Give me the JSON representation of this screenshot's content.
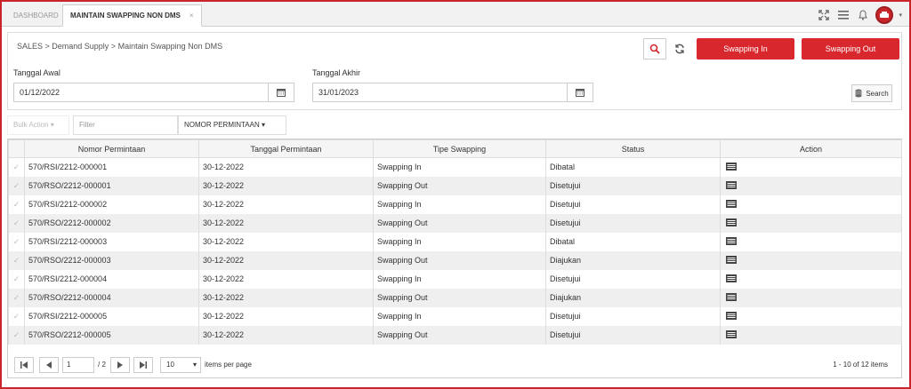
{
  "tabs": [
    {
      "label": "DASHBOARD"
    },
    {
      "label": "MAINTAIN SWAPPING NON DMS",
      "close": "×"
    }
  ],
  "icons": {
    "fullscreen": "expand-icon",
    "menu": "hamburger-icon",
    "bell": "bell-icon",
    "user": "avatar"
  },
  "breadcrumb": "SALES > Demand Supply > Maintain Swapping Non DMS",
  "actions": {
    "swap_in": "Swapping In",
    "swap_out": "Swapping Out"
  },
  "form": {
    "start_label": "Tanggal Awal",
    "start_value": "01/12/2022",
    "end_label": "Tanggal Akhir",
    "end_value": "31/01/2023",
    "search": "Search"
  },
  "toolbar": {
    "bulk": "Bulk Action ▾",
    "filter_placeholder": "Filter",
    "field": "NOMOR PERMINTAAN ▾"
  },
  "table": {
    "headers": [
      "Nomor Permintaan",
      "Tanggal Permintaan",
      "Tipe Swapping",
      "Status",
      "Action"
    ],
    "rows": [
      [
        "570/RSI/2212-000001",
        "30-12-2022",
        "Swapping In",
        "Dibatal"
      ],
      [
        "570/RSO/2212-000001",
        "30-12-2022",
        "Swapping Out",
        "Disetujui"
      ],
      [
        "570/RSI/2212-000002",
        "30-12-2022",
        "Swapping In",
        "Disetujui"
      ],
      [
        "570/RSO/2212-000002",
        "30-12-2022",
        "Swapping Out",
        "Disetujui"
      ],
      [
        "570/RSI/2212-000003",
        "30-12-2022",
        "Swapping In",
        "Dibatal"
      ],
      [
        "570/RSO/2212-000003",
        "30-12-2022",
        "Swapping Out",
        "Diajukan"
      ],
      [
        "570/RSI/2212-000004",
        "30-12-2022",
        "Swapping In",
        "Disetujui"
      ],
      [
        "570/RSO/2212-000004",
        "30-12-2022",
        "Swapping Out",
        "Diajukan"
      ],
      [
        "570/RSI/2212-000005",
        "30-12-2022",
        "Swapping In",
        "Disetujui"
      ],
      [
        "570/RSO/2212-000005",
        "30-12-2022",
        "Swapping Out",
        "Disetujui"
      ]
    ]
  },
  "pager": {
    "page": "1",
    "of": "/ 2",
    "per_page": "10",
    "per_page_label": "items per page",
    "summary": "1 - 10 of 12 items"
  },
  "colors": {
    "accent": "#d9272e",
    "border": "#c8262b"
  }
}
